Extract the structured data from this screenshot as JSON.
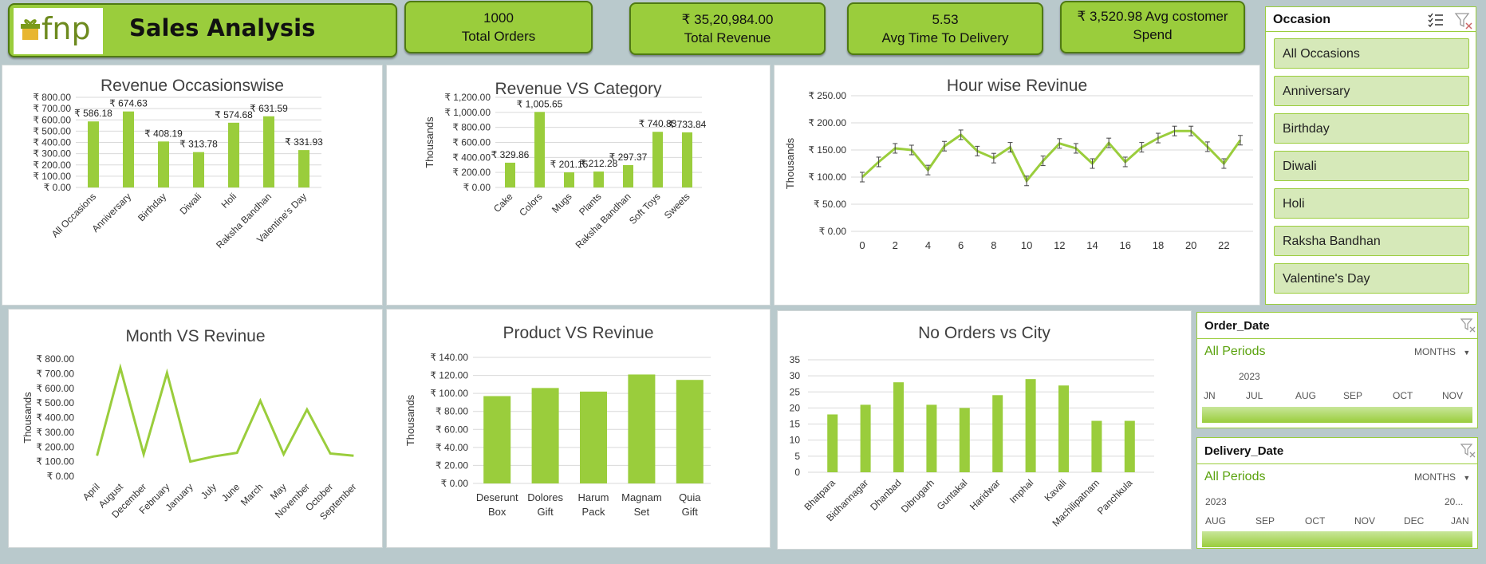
{
  "header": {
    "logo_text": "fnp",
    "title": "Sales Analysis"
  },
  "kpis": [
    {
      "value": "1000",
      "label": "Total Orders"
    },
    {
      "value": "₹ 35,20,984.00",
      "label": "Total Revenue"
    },
    {
      "value": "5.53",
      "label": "Avg Time To Delivery"
    },
    {
      "value": "₹ 3,520.98 Avg costomer",
      "label": "Spend"
    }
  ],
  "colors": {
    "accent": "#9acd3c",
    "dark_green": "#4f7a12",
    "bar": "#9acd3c"
  },
  "occasion_slicer": {
    "title": "Occasion",
    "items": [
      "All Occasions",
      "Anniversary",
      "Birthday",
      "Diwali",
      "Holi",
      "Raksha Bandhan",
      "Valentine's Day"
    ]
  },
  "order_date": {
    "title": "Order_Date",
    "period": "All Periods",
    "level": "MONTHS",
    "year": "2023",
    "months": [
      "JN",
      "JUL",
      "AUG",
      "SEP",
      "OCT",
      "NOV"
    ]
  },
  "delivery_date": {
    "title": "Delivery_Date",
    "period": "All Periods",
    "level": "MONTHS",
    "year": "2023",
    "year2": "20...",
    "months": [
      "AUG",
      "SEP",
      "OCT",
      "NOV",
      "DEC",
      "JAN"
    ]
  },
  "chart_data": [
    {
      "id": "occasion",
      "type": "bar",
      "title": "Revenue Occasionswise",
      "categories": [
        "All Occasions",
        "Anniversary",
        "Birthday",
        "Diwali",
        "Holi",
        "Raksha Bandhan",
        "Valentine's Day"
      ],
      "values": [
        586.18,
        674.63,
        408.19,
        313.78,
        574.68,
        631.59,
        331.93
      ],
      "data_labels": [
        "₹ 586.18",
        "₹ 674.63",
        "₹ 408.19",
        "₹ 313.78",
        "₹ 574.68",
        "₹ 631.59",
        "₹ 331.93"
      ],
      "yticks": [
        "₹ 0.00",
        "₹ 100.00",
        "₹ 200.00",
        "₹ 300.00",
        "₹ 400.00",
        "₹ 500.00",
        "₹ 600.00",
        "₹ 700.00",
        "₹ 800.00"
      ],
      "ylim": [
        0,
        800
      ],
      "ylabel": "",
      "grid": true
    },
    {
      "id": "category",
      "type": "bar",
      "title": "Revenue VS Category",
      "categories": [
        "Cake",
        "Colors",
        "Mugs",
        "Plants",
        "Raksha Bandhan",
        "Soft Toys",
        "Sweets"
      ],
      "values": [
        329.86,
        1005.65,
        201.15,
        212.28,
        297.37,
        740.83,
        733.84
      ],
      "data_labels": [
        "₹ 329.86",
        "₹ 1,005.65",
        "₹ 201.15",
        "₹ 212.28",
        "₹ 297.37",
        "₹ 740.83",
        "₹ 733.84"
      ],
      "yticks": [
        "₹ 0.00",
        "₹ 200.00",
        "₹ 400.00",
        "₹ 600.00",
        "₹ 800.00",
        "₹ 1,000.00",
        "₹ 1,200.00"
      ],
      "ylim": [
        0,
        1200
      ],
      "ylabel": "Thousands",
      "grid": true
    },
    {
      "id": "hour",
      "type": "line",
      "title": "Hour wise Revinue",
      "x": [
        0,
        1,
        2,
        3,
        4,
        5,
        6,
        7,
        8,
        9,
        10,
        11,
        12,
        13,
        14,
        15,
        16,
        17,
        18,
        19,
        20,
        21,
        22,
        23
      ],
      "values": [
        100,
        128,
        153,
        150,
        113,
        157,
        178,
        148,
        135,
        155,
        93,
        130,
        162,
        153,
        125,
        163,
        128,
        155,
        172,
        185,
        185,
        156,
        125,
        168
      ],
      "xticks": [
        "0",
        "2",
        "4",
        "6",
        "8",
        "10",
        "12",
        "14",
        "16",
        "18",
        "20",
        "22"
      ],
      "yticks": [
        "₹ 0.00",
        "₹ 50.00",
        "₹ 100.00",
        "₹ 150.00",
        "₹ 200.00",
        "₹ 250.00"
      ],
      "ylim": [
        0,
        250
      ],
      "ylabel": "Thousands",
      "grid": true,
      "error_bars": true
    },
    {
      "id": "month",
      "type": "line",
      "title": "Month VS Revinue",
      "categories": [
        "April",
        "August",
        "December",
        "February",
        "January",
        "July",
        "June",
        "March",
        "May",
        "November",
        "October",
        "September"
      ],
      "values": [
        140,
        740,
        150,
        705,
        100,
        135,
        160,
        515,
        150,
        455,
        155,
        140
      ],
      "yticks": [
        "₹ 0.00",
        "₹ 100.00",
        "₹ 200.00",
        "₹ 300.00",
        "₹ 400.00",
        "₹ 500.00",
        "₹ 600.00",
        "₹ 700.00",
        "₹ 800.00"
      ],
      "ylim": [
        0,
        800
      ],
      "ylabel": "Thousands",
      "grid": false
    },
    {
      "id": "product",
      "type": "bar",
      "title": "Product VS Revinue",
      "categories": [
        "Deserunt Box",
        "Dolores Gift",
        "Harum Pack",
        "Magnam Set",
        "Quia Gift"
      ],
      "values": [
        97,
        106,
        102,
        121,
        115
      ],
      "yticks": [
        "₹ 0.00",
        "₹ 20.00",
        "₹ 40.00",
        "₹ 60.00",
        "₹ 80.00",
        "₹ 100.00",
        "₹ 120.00",
        "₹ 140.00"
      ],
      "ylim": [
        0,
        140
      ],
      "ylabel": "Thousands",
      "grid": true
    },
    {
      "id": "city",
      "type": "bar",
      "title": "No Orders  vs City",
      "categories": [
        "Bhatpara",
        "Bidhannagar",
        "Dhanbad",
        "Dibrugarh",
        "Guntakal",
        "Haridwar",
        "Imphal",
        "Kavali",
        "Machilipatnam",
        "Panchkula"
      ],
      "values": [
        18,
        21,
        28,
        21,
        20,
        24,
        29,
        27,
        16,
        16
      ],
      "yticks": [
        "0",
        "5",
        "10",
        "15",
        "20",
        "25",
        "30",
        "35"
      ],
      "ylim": [
        0,
        35
      ],
      "ylabel": "",
      "grid": true
    }
  ]
}
